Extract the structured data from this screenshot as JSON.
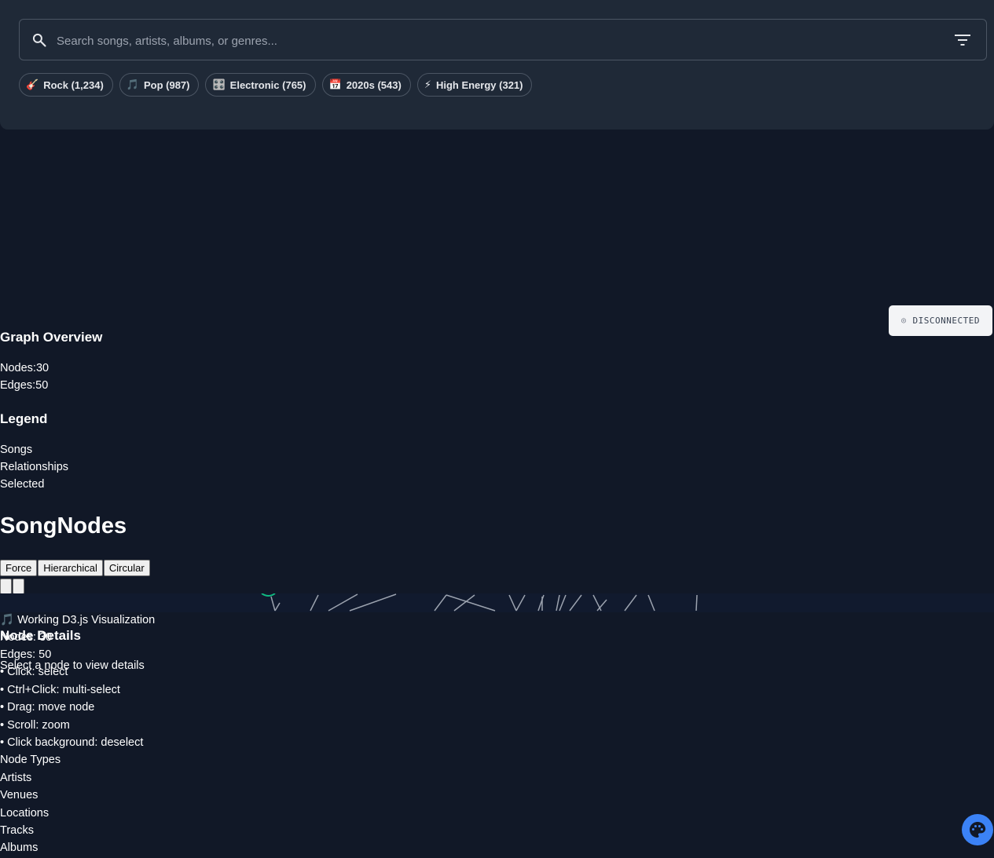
{
  "search": {
    "placeholder": "Search songs, artists, albums, or genres...",
    "icon": "search-icon",
    "filter_icon": "filter-icon"
  },
  "chips": [
    {
      "icon": "🎸",
      "label": "Rock (1,234)"
    },
    {
      "icon": "🎵",
      "label": "Pop (987)"
    },
    {
      "icon": "🎛️",
      "label": "Electronic (765)"
    },
    {
      "icon": "📅",
      "label": "2020s (543)"
    },
    {
      "icon": "⚡",
      "label": "High Energy (321)"
    }
  ],
  "status": {
    "icon": "◎",
    "label": "DISCONNECTED"
  },
  "overview": {
    "title": "Graph Overview",
    "nodes_label": "Nodes:",
    "nodes_value": "30",
    "edges_label": "Edges:",
    "edges_value": "50"
  },
  "legend": {
    "title": "Legend",
    "items": [
      "Songs",
      "Relationships",
      "Selected"
    ]
  },
  "app": {
    "title": "SongNodes"
  },
  "layouts": [
    "Force",
    "Hierarchical",
    "Circular"
  ],
  "viz": {
    "title": "🎵 Working D3.js Visualization",
    "nodes_text": "Nodes: 30",
    "edges_text": "Edges: 50",
    "hints": [
      "• Click: select",
      "• Ctrl+Click: multi-select",
      "• Drag: move node",
      "• Scroll: zoom",
      "• Click background: deselect"
    ],
    "node_types_title": "Node Types",
    "node_types": [
      "Artists",
      "Venues",
      "Locations",
      "Tracks",
      "Albums"
    ]
  },
  "details": {
    "title": "Node Details",
    "empty": "Select a node to view details"
  },
  "colors": {
    "background": "#111827",
    "panel": "#1f2937",
    "edge": "#9ca3af",
    "accent": "#3b82f6",
    "node_selected": "#10b981"
  },
  "palette_icon": "palette-icon"
}
